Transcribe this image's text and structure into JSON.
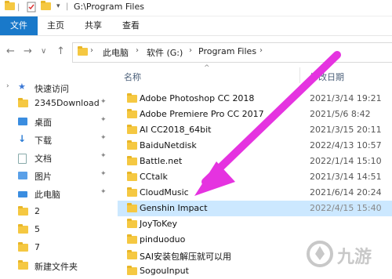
{
  "window": {
    "title": "G:\\Program Files"
  },
  "ribbon": {
    "tabs": [
      "文件",
      "主页",
      "共享",
      "查看"
    ]
  },
  "nav": {
    "back": "←",
    "forward": "→",
    "dropdown": "∨",
    "up": "↑",
    "breadcrumb": [
      "此电脑",
      "软件 (G:)",
      "Program Files"
    ],
    "separator": "›"
  },
  "sidebar": {
    "items": [
      {
        "label": "快速访问",
        "pinned": false,
        "icon": "star-icon"
      },
      {
        "label": "2345Download",
        "pinned": true,
        "icon": "folder-icon"
      },
      {
        "label": "桌面",
        "pinned": true,
        "icon": "desktop-icon"
      },
      {
        "label": "下载",
        "pinned": true,
        "icon": "download-icon"
      },
      {
        "label": "文档",
        "pinned": true,
        "icon": "documents-icon"
      },
      {
        "label": "图片",
        "pinned": true,
        "icon": "pictures-icon"
      },
      {
        "label": "此电脑",
        "pinned": true,
        "icon": "this-pc-icon"
      },
      {
        "label": "2",
        "pinned": false,
        "icon": "folder-icon"
      },
      {
        "label": "5",
        "pinned": false,
        "icon": "folder-icon"
      },
      {
        "label": "7",
        "pinned": false,
        "icon": "folder-icon"
      },
      {
        "label": "新建文件夹",
        "pinned": false,
        "icon": "folder-icon"
      }
    ],
    "pin_glyph": "📌"
  },
  "filelist": {
    "columns": {
      "name": "名称",
      "modified": "修改日期"
    },
    "sort_glyph": "^",
    "rows": [
      {
        "name": "Adobe Photoshop CC 2018",
        "date": "2021/3/14 19:21"
      },
      {
        "name": "Adobe Premiere Pro CC 2017",
        "date": "2021/5/6 8:42"
      },
      {
        "name": "AI CC2018_64bit",
        "date": "2021/3/15 20:11"
      },
      {
        "name": "BaiduNetdisk",
        "date": "2022/4/13 10:57"
      },
      {
        "name": "Battle.net",
        "date": "2022/1/14 15:10"
      },
      {
        "name": "CCtalk",
        "date": "2021/3/14 14:51"
      },
      {
        "name": "CloudMusic",
        "date": "2021/6/14 20:24"
      },
      {
        "name": "Genshin Impact",
        "date": "2022/4/15 15:40",
        "selected": true
      },
      {
        "name": "JoyToKey",
        "date": ""
      },
      {
        "name": "pinduoduo",
        "date": ""
      },
      {
        "name": "SAI安装包解压就可以用",
        "date": ""
      },
      {
        "name": "SogouInput",
        "date": ""
      }
    ]
  },
  "colors": {
    "accent": "#1979ca",
    "selection": "#cce8ff",
    "folder": "#f5c842",
    "arrow": "#e533e0"
  },
  "watermark": {
    "text": "九游"
  }
}
